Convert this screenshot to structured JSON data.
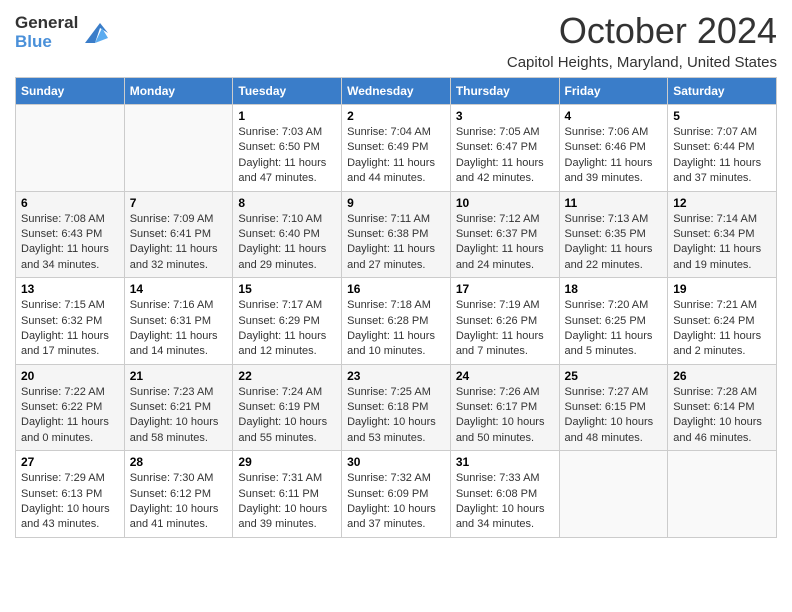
{
  "logo": {
    "general": "General",
    "blue": "Blue"
  },
  "title": {
    "month": "October 2024",
    "location": "Capitol Heights, Maryland, United States"
  },
  "days_of_week": [
    "Sunday",
    "Monday",
    "Tuesday",
    "Wednesday",
    "Thursday",
    "Friday",
    "Saturday"
  ],
  "weeks": [
    [
      {
        "num": "",
        "info": ""
      },
      {
        "num": "",
        "info": ""
      },
      {
        "num": "1",
        "info": "Sunrise: 7:03 AM\nSunset: 6:50 PM\nDaylight: 11 hours and 47 minutes."
      },
      {
        "num": "2",
        "info": "Sunrise: 7:04 AM\nSunset: 6:49 PM\nDaylight: 11 hours and 44 minutes."
      },
      {
        "num": "3",
        "info": "Sunrise: 7:05 AM\nSunset: 6:47 PM\nDaylight: 11 hours and 42 minutes."
      },
      {
        "num": "4",
        "info": "Sunrise: 7:06 AM\nSunset: 6:46 PM\nDaylight: 11 hours and 39 minutes."
      },
      {
        "num": "5",
        "info": "Sunrise: 7:07 AM\nSunset: 6:44 PM\nDaylight: 11 hours and 37 minutes."
      }
    ],
    [
      {
        "num": "6",
        "info": "Sunrise: 7:08 AM\nSunset: 6:43 PM\nDaylight: 11 hours and 34 minutes."
      },
      {
        "num": "7",
        "info": "Sunrise: 7:09 AM\nSunset: 6:41 PM\nDaylight: 11 hours and 32 minutes."
      },
      {
        "num": "8",
        "info": "Sunrise: 7:10 AM\nSunset: 6:40 PM\nDaylight: 11 hours and 29 minutes."
      },
      {
        "num": "9",
        "info": "Sunrise: 7:11 AM\nSunset: 6:38 PM\nDaylight: 11 hours and 27 minutes."
      },
      {
        "num": "10",
        "info": "Sunrise: 7:12 AM\nSunset: 6:37 PM\nDaylight: 11 hours and 24 minutes."
      },
      {
        "num": "11",
        "info": "Sunrise: 7:13 AM\nSunset: 6:35 PM\nDaylight: 11 hours and 22 minutes."
      },
      {
        "num": "12",
        "info": "Sunrise: 7:14 AM\nSunset: 6:34 PM\nDaylight: 11 hours and 19 minutes."
      }
    ],
    [
      {
        "num": "13",
        "info": "Sunrise: 7:15 AM\nSunset: 6:32 PM\nDaylight: 11 hours and 17 minutes."
      },
      {
        "num": "14",
        "info": "Sunrise: 7:16 AM\nSunset: 6:31 PM\nDaylight: 11 hours and 14 minutes."
      },
      {
        "num": "15",
        "info": "Sunrise: 7:17 AM\nSunset: 6:29 PM\nDaylight: 11 hours and 12 minutes."
      },
      {
        "num": "16",
        "info": "Sunrise: 7:18 AM\nSunset: 6:28 PM\nDaylight: 11 hours and 10 minutes."
      },
      {
        "num": "17",
        "info": "Sunrise: 7:19 AM\nSunset: 6:26 PM\nDaylight: 11 hours and 7 minutes."
      },
      {
        "num": "18",
        "info": "Sunrise: 7:20 AM\nSunset: 6:25 PM\nDaylight: 11 hours and 5 minutes."
      },
      {
        "num": "19",
        "info": "Sunrise: 7:21 AM\nSunset: 6:24 PM\nDaylight: 11 hours and 2 minutes."
      }
    ],
    [
      {
        "num": "20",
        "info": "Sunrise: 7:22 AM\nSunset: 6:22 PM\nDaylight: 11 hours and 0 minutes."
      },
      {
        "num": "21",
        "info": "Sunrise: 7:23 AM\nSunset: 6:21 PM\nDaylight: 10 hours and 58 minutes."
      },
      {
        "num": "22",
        "info": "Sunrise: 7:24 AM\nSunset: 6:19 PM\nDaylight: 10 hours and 55 minutes."
      },
      {
        "num": "23",
        "info": "Sunrise: 7:25 AM\nSunset: 6:18 PM\nDaylight: 10 hours and 53 minutes."
      },
      {
        "num": "24",
        "info": "Sunrise: 7:26 AM\nSunset: 6:17 PM\nDaylight: 10 hours and 50 minutes."
      },
      {
        "num": "25",
        "info": "Sunrise: 7:27 AM\nSunset: 6:15 PM\nDaylight: 10 hours and 48 minutes."
      },
      {
        "num": "26",
        "info": "Sunrise: 7:28 AM\nSunset: 6:14 PM\nDaylight: 10 hours and 46 minutes."
      }
    ],
    [
      {
        "num": "27",
        "info": "Sunrise: 7:29 AM\nSunset: 6:13 PM\nDaylight: 10 hours and 43 minutes."
      },
      {
        "num": "28",
        "info": "Sunrise: 7:30 AM\nSunset: 6:12 PM\nDaylight: 10 hours and 41 minutes."
      },
      {
        "num": "29",
        "info": "Sunrise: 7:31 AM\nSunset: 6:11 PM\nDaylight: 10 hours and 39 minutes."
      },
      {
        "num": "30",
        "info": "Sunrise: 7:32 AM\nSunset: 6:09 PM\nDaylight: 10 hours and 37 minutes."
      },
      {
        "num": "31",
        "info": "Sunrise: 7:33 AM\nSunset: 6:08 PM\nDaylight: 10 hours and 34 minutes."
      },
      {
        "num": "",
        "info": ""
      },
      {
        "num": "",
        "info": ""
      }
    ]
  ]
}
